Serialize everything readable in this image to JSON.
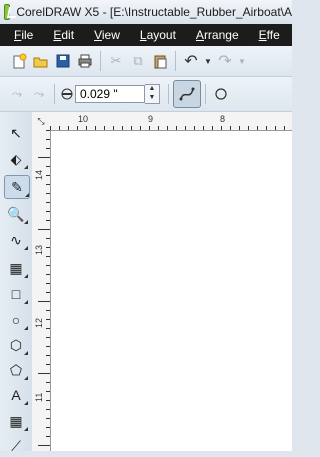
{
  "window": {
    "title": "CorelDRAW X5 - [E:\\Instructable_Rubber_Airboat\\A"
  },
  "menu": {
    "items": [
      {
        "label": "File"
      },
      {
        "label": "Edit"
      },
      {
        "label": "View"
      },
      {
        "label": "Layout"
      },
      {
        "label": "Arrange"
      },
      {
        "label": "Effe"
      }
    ]
  },
  "toolbar": {
    "icons": [
      "new-icon",
      "open-icon",
      "save-icon",
      "print-icon",
      "cut-icon",
      "copy-icon",
      "paste-icon",
      "undo-icon",
      "dropdown-icon",
      "redo-icon",
      "redo-dropdown-icon"
    ]
  },
  "property_bar": {
    "outline_width": "0.029 \"",
    "icons": [
      "segment-icon",
      "node-icon",
      "outline-width-icon",
      "spin-up-icon",
      "spin-down-icon",
      "freehand-mode-icon",
      "circle-icon"
    ]
  },
  "rulers": {
    "horizontal_numbers": [
      "10",
      "9",
      "8"
    ],
    "vertical_numbers": [
      "14",
      "13",
      "12",
      "11"
    ],
    "corner_glyph": "⤡"
  },
  "toolbox": {
    "tools": [
      {
        "name": "pick-tool-icon",
        "glyph": "↖"
      },
      {
        "name": "shape-tool-icon",
        "glyph": "⬖"
      },
      {
        "name": "freehand-tool-icon",
        "glyph": "✎"
      },
      {
        "name": "zoom-tool-icon",
        "glyph": "🔍"
      },
      {
        "name": "smart-drawing-tool-icon",
        "glyph": "∿"
      },
      {
        "name": "smart-fill-tool-icon",
        "glyph": "▦"
      },
      {
        "name": "rectangle-tool-icon",
        "glyph": "□"
      },
      {
        "name": "ellipse-tool-icon",
        "glyph": "○"
      },
      {
        "name": "polygon-tool-icon",
        "glyph": "⬡"
      },
      {
        "name": "basic-shapes-tool-icon",
        "glyph": "⬠"
      },
      {
        "name": "text-tool-icon",
        "glyph": "A"
      },
      {
        "name": "table-tool-icon",
        "glyph": "▦"
      },
      {
        "name": "parallel-dimension-tool-icon",
        "glyph": "⟋"
      }
    ]
  }
}
